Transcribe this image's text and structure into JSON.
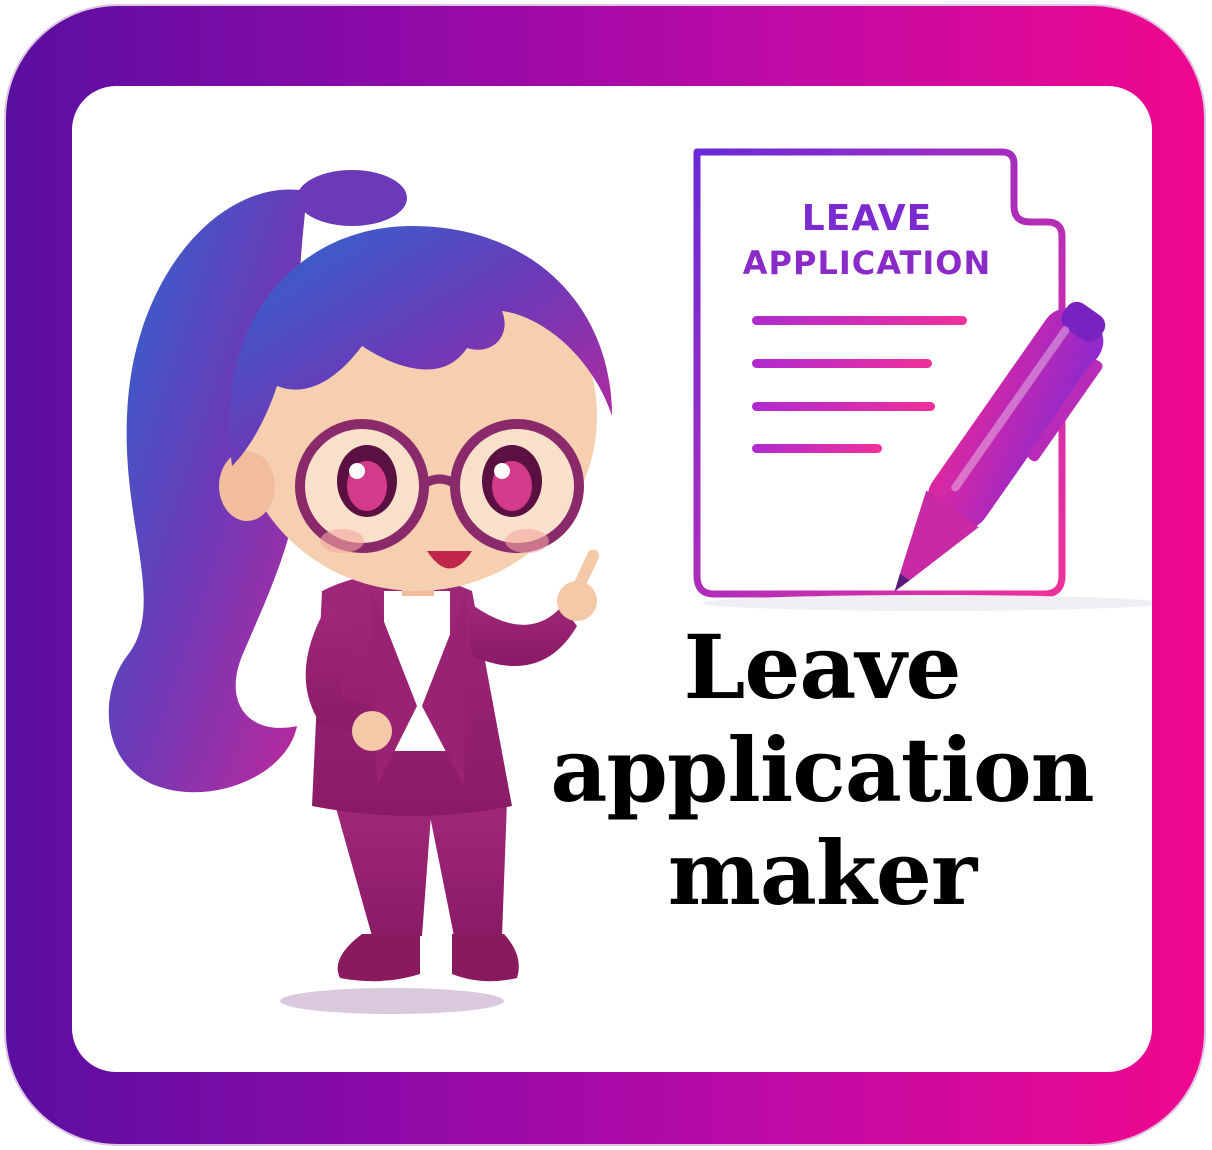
{
  "document_icon": {
    "title_line1": "LEAVE",
    "title_line2": "APPLICATION",
    "pen_icon": "pen-icon"
  },
  "headline": {
    "line1": "Leave",
    "line2": "application",
    "line3": "maker"
  },
  "colors": {
    "frame_start": "#5a0fa0",
    "frame_end": "#f0088e",
    "doc_text": "#7a2ad0",
    "headline_text": "#000000"
  }
}
